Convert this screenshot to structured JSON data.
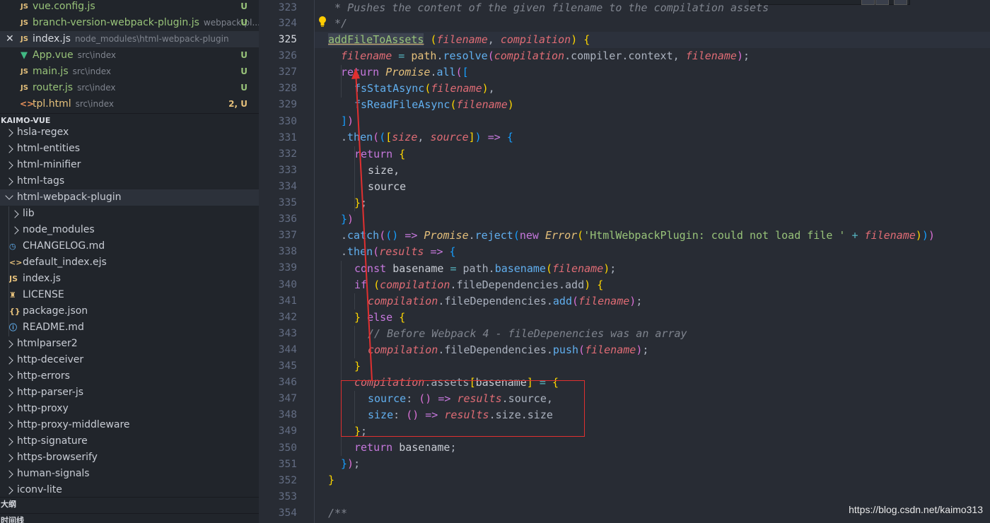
{
  "open_editors": [
    {
      "name": "vue.config.js",
      "path": "",
      "type": "js",
      "status": "U"
    },
    {
      "name": "branch-version-webpack-plugin.js",
      "path": "webpack-pl...",
      "type": "js",
      "status": "U"
    },
    {
      "name": "index.js",
      "path": "node_modules\\html-webpack-plugin",
      "type": "js",
      "status": "",
      "active": true
    },
    {
      "name": "App.vue",
      "path": "src\\index",
      "type": "vue",
      "status": "U"
    },
    {
      "name": "main.js",
      "path": "src\\index",
      "type": "js",
      "status": "U"
    },
    {
      "name": "router.js",
      "path": "src\\index",
      "type": "js",
      "status": "U"
    },
    {
      "name": "tpl.html",
      "path": "src\\index",
      "type": "html",
      "status": "2, U"
    }
  ],
  "explorer_title": "KAIMO-VUE",
  "tree": [
    {
      "label": "hsla-regex",
      "kind": "folder",
      "depth": 0
    },
    {
      "label": "html-entities",
      "kind": "folder",
      "depth": 0
    },
    {
      "label": "html-minifier",
      "kind": "folder",
      "depth": 0
    },
    {
      "label": "html-tags",
      "kind": "folder",
      "depth": 0
    },
    {
      "label": "html-webpack-plugin",
      "kind": "folder-open",
      "depth": 0
    },
    {
      "label": "lib",
      "kind": "folder",
      "depth": 1
    },
    {
      "label": "node_modules",
      "kind": "folder",
      "depth": 1
    },
    {
      "label": "CHANGELOG.md",
      "kind": "changelog",
      "depth": 1
    },
    {
      "label": "default_index.ejs",
      "kind": "ejs",
      "depth": 1
    },
    {
      "label": "index.js",
      "kind": "js",
      "depth": 1
    },
    {
      "label": "LICENSE",
      "kind": "license",
      "depth": 1
    },
    {
      "label": "package.json",
      "kind": "json",
      "depth": 1
    },
    {
      "label": "README.md",
      "kind": "readme",
      "depth": 1
    },
    {
      "label": "htmlparser2",
      "kind": "folder",
      "depth": 0
    },
    {
      "label": "http-deceiver",
      "kind": "folder",
      "depth": 0
    },
    {
      "label": "http-errors",
      "kind": "folder",
      "depth": 0
    },
    {
      "label": "http-parser-js",
      "kind": "folder",
      "depth": 0
    },
    {
      "label": "http-proxy",
      "kind": "folder",
      "depth": 0
    },
    {
      "label": "http-proxy-middleware",
      "kind": "folder",
      "depth": 0
    },
    {
      "label": "http-signature",
      "kind": "folder",
      "depth": 0
    },
    {
      "label": "https-browserify",
      "kind": "folder",
      "depth": 0
    },
    {
      "label": "human-signals",
      "kind": "folder",
      "depth": 0
    },
    {
      "label": "iconv-lite",
      "kind": "folder",
      "depth": 0
    }
  ],
  "outline_title": "大纲",
  "timeline_title": "时间线",
  "line_numbers": [
    "323",
    "324",
    "325",
    "326",
    "327",
    "328",
    "329",
    "330",
    "331",
    "332",
    "333",
    "334",
    "335",
    "336",
    "337",
    "338",
    "339",
    "340",
    "341",
    "342",
    "343",
    "344",
    "345",
    "346",
    "347",
    "348",
    "349",
    "350",
    "351",
    "352",
    "353",
    "354"
  ],
  "current_line": "325",
  "code_text": {
    "l323": " * Pushes the content of the given filename to the compilation assets",
    "l324": " */",
    "l325_fn": "addFileToAssets",
    "l337_str": "'HtmlWebpackPlugin: could not load file '",
    "l343_comment": "// Before Webpack 4 - fileDepenencies was an array",
    "l354": "/**"
  },
  "watermark": "https://blog.csdn.net/kaimo313",
  "colors": {
    "annotation": "#e03030",
    "background": "#282c34",
    "sidebar": "#21252b"
  }
}
